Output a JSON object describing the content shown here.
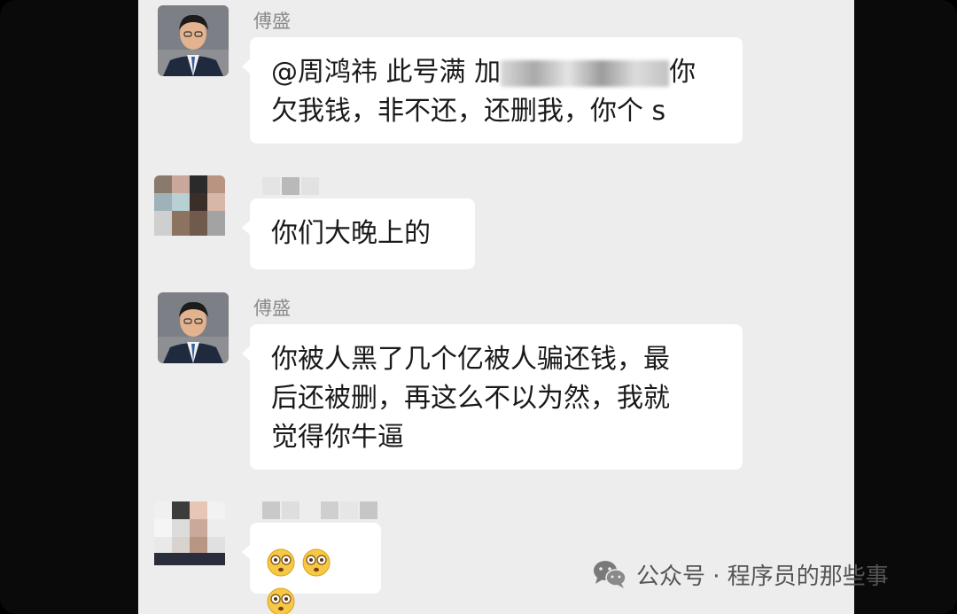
{
  "messages": [
    {
      "sender": "傅盛",
      "lines": [
        "@周鸿祎 此号满 加",
        "你",
        "欠我钱，非不还，还删我，你个 s"
      ]
    },
    {
      "sender": "",
      "lines": [
        "你们大晚上的"
      ]
    },
    {
      "sender": "傅盛",
      "lines": [
        "你被人黑了几个亿被人骗还钱，最",
        "后还被删，再这么不以为然，我就",
        "觉得你牛逼"
      ]
    },
    {
      "sender": "",
      "emoji_count": 3
    }
  ],
  "watermark": {
    "text": "公众号 · 程序员的那些事",
    "icon": "wechat-icon"
  },
  "colors": {
    "chat_bg": "#ededed",
    "bubble_bg": "#ffffff",
    "name_color": "#8a8a8a",
    "text_color": "#191919"
  }
}
